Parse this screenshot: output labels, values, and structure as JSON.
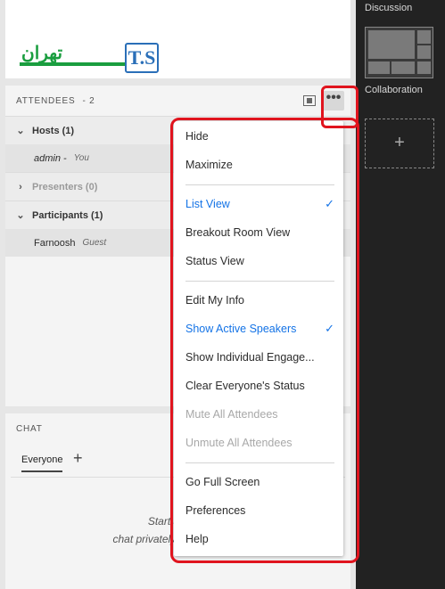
{
  "logo": {
    "text_fa": "تهران",
    "text_ts": "T.S",
    "text_fa2": "تهرا"
  },
  "attendees": {
    "title": "ATTENDEES",
    "count": "- 2",
    "more_glyph": "•••",
    "groups": {
      "hosts": {
        "label": "Hosts (1)",
        "chevron": "⌄"
      },
      "presenters": {
        "label": "Presenters (0)",
        "chevron": "›"
      },
      "participants": {
        "label": "Participants (1)",
        "chevron": "⌄"
      }
    },
    "people": {
      "admin": {
        "name": "admin -",
        "role": "You"
      },
      "farnoosh": {
        "name": "Farnoosh",
        "role": "Guest"
      }
    }
  },
  "chat": {
    "title": "CHAT",
    "tab": "Everyone",
    "add_glyph": "+",
    "hint_line1": "Start a conversa",
    "hint_line2": "chat privately with the Ho"
  },
  "sidebar": {
    "discussion": "Discussion",
    "collaboration": "Collaboration",
    "add_glyph": "+"
  },
  "menu": {
    "check_glyph": "✓",
    "items": {
      "hide": "Hide",
      "maximize": "Maximize",
      "list_view": "List View",
      "breakout": "Breakout Room View",
      "status_view": "Status View",
      "edit_info": "Edit My Info",
      "show_active": "Show Active Speakers",
      "show_individual": "Show Individual Engage...",
      "clear_status": "Clear Everyone's Status",
      "mute_all": "Mute All Attendees",
      "unmute_all": "Unmute All Attendees",
      "full_screen": "Go Full Screen",
      "preferences": "Preferences",
      "help": "Help"
    }
  },
  "colors": {
    "accent": "#1473e6",
    "highlight": "#e0141e",
    "sidebar_bg": "#222222"
  }
}
